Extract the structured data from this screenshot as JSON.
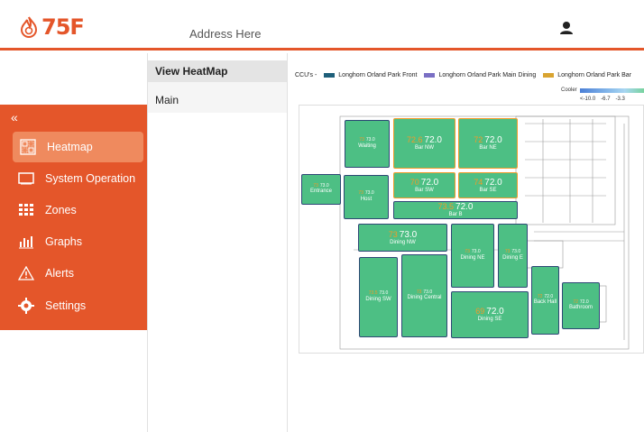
{
  "header": {
    "logo_text": "75F",
    "address": "Address Here"
  },
  "sidebar": {
    "collapse_glyph": "«",
    "items": [
      {
        "label": "Heatmap",
        "icon": "heatmap-icon",
        "active": true
      },
      {
        "label": "System Operation",
        "icon": "monitor-icon",
        "active": false
      },
      {
        "label": "Zones",
        "icon": "grid-icon",
        "active": false
      },
      {
        "label": "Graphs",
        "icon": "bar-chart-icon",
        "active": false
      },
      {
        "label": "Alerts",
        "icon": "warning-icon",
        "active": false
      },
      {
        "label": "Settings",
        "icon": "gear-icon",
        "active": false
      }
    ]
  },
  "panel": {
    "header": "View HeatMap",
    "items": [
      "Main"
    ]
  },
  "legend": {
    "prefix": "CCU's -",
    "ccus": [
      {
        "name": "Longhorn Orland Park Front",
        "color": "#1e5f7a"
      },
      {
        "name": "Longhorn Orland Park Main Dining",
        "color": "#7a6fc4"
      },
      {
        "name": "Longhorn Orland Park Bar",
        "color": "#d9a431"
      }
    ],
    "scale_label": "Cooler",
    "scale_ticks": [
      "<-10.0",
      "-6.7",
      "-3.3"
    ]
  },
  "zones": [
    {
      "name": "Waiting",
      "current": "73",
      "setpoint": "73.0"
    },
    {
      "name": "Bar NW",
      "current": "72.6",
      "setpoint": "72.0"
    },
    {
      "name": "Bar NE",
      "current": "72",
      "setpoint": "72.0"
    },
    {
      "name": "Entrance",
      "current": "73",
      "setpoint": "73.0"
    },
    {
      "name": "Host",
      "current": "73",
      "setpoint": "73.0"
    },
    {
      "name": "Bar SW",
      "current": "70",
      "setpoint": "72.0"
    },
    {
      "name": "Bar SE",
      "current": "74",
      "setpoint": "72.0"
    },
    {
      "name": "Bar B",
      "current": "73.5",
      "setpoint": "72.0"
    },
    {
      "name": "Dining NW",
      "current": "73",
      "setpoint": "73.0"
    },
    {
      "name": "Dining NE",
      "current": "73",
      "setpoint": "73.0"
    },
    {
      "name": "Dining E",
      "current": "73",
      "setpoint": "73.0"
    },
    {
      "name": "Dining SW",
      "current": "73.5",
      "setpoint": "73.0"
    },
    {
      "name": "Dining Central",
      "current": "73",
      "setpoint": "73.0"
    },
    {
      "name": "Dining SE",
      "current": "69",
      "setpoint": "72.0"
    },
    {
      "name": "Back Hall",
      "current": "72",
      "setpoint": "72.0"
    },
    {
      "name": "Bathroom",
      "current": "72",
      "setpoint": "72.0"
    }
  ]
}
